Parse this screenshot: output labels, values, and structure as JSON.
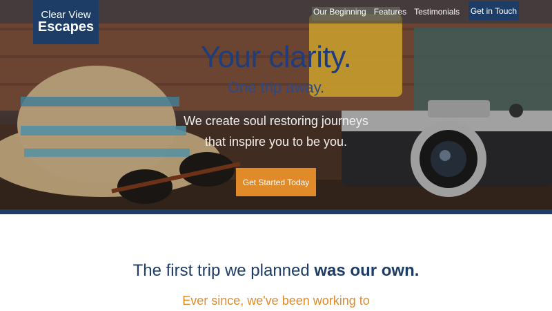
{
  "brand": {
    "line1": "Clear View",
    "line2": "Escapes"
  },
  "nav": {
    "links": [
      "Our Beginning",
      "Features",
      "Testimonials"
    ],
    "cta": "Get in Touch"
  },
  "hero": {
    "title": "Your clarity.",
    "subtitle": "One trip away.",
    "description_line1": "We create soul restoring journeys",
    "description_line2": "that inspire you to be you.",
    "button": "Get Started Today"
  },
  "story": {
    "title_regular": "The first trip we planned ",
    "title_bold": "was our own.",
    "subtitle": "Ever since, we've been working to"
  },
  "colors": {
    "brand_navy": "#1e3d66",
    "accent_orange": "#e08a2a"
  }
}
